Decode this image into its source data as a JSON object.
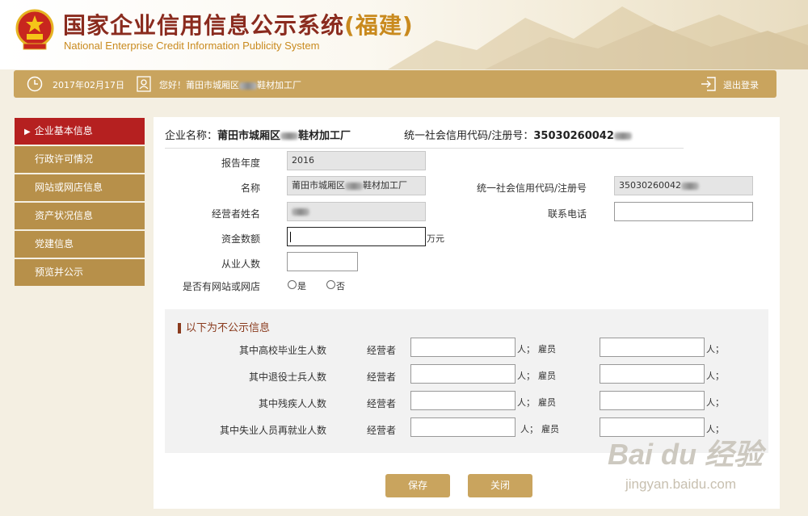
{
  "header": {
    "title_cn": "国家企业信用信息公示系统",
    "title_province": "(福建)",
    "title_en": "National Enterprise Credit Information Publicity System"
  },
  "topbar": {
    "date": "2017年02月17日",
    "greeting_prefix": "您好！莆田市城厢区",
    "greeting_suffix": "鞋材加工厂",
    "logout": "退出登录"
  },
  "sidebar": {
    "items": [
      {
        "label": "企业基本信息",
        "active": true
      },
      {
        "label": "行政许可情况"
      },
      {
        "label": "网站或网店信息"
      },
      {
        "label": "资产状况信息"
      },
      {
        "label": "党建信息"
      },
      {
        "label": "预览并公示"
      }
    ]
  },
  "summary": {
    "name_label": "企业名称：",
    "name_prefix": "莆田市城厢区",
    "name_suffix": "鞋材加工厂",
    "code_label": "统一社会信用代码/注册号：",
    "code_value": "35030260042"
  },
  "form": {
    "year_label": "报告年度",
    "year_value": "2016",
    "name_label": "名称",
    "name_prefix": "莆田市城厢区",
    "name_suffix": "鞋材加工厂",
    "code_label": "统一社会信用代码/注册号",
    "code_value": "35030260042",
    "operator_label": "经营者姓名",
    "phone_label": "联系电话",
    "capital_label": "资金数额",
    "capital_unit": "万元",
    "employees_label": "从业人数",
    "website_label": "是否有网站或网店",
    "yes": "是",
    "no": "否"
  },
  "nonpublic": {
    "title": "以下为不公示信息",
    "operator": "经营者",
    "unit_ren": "人；",
    "employee": "雇员",
    "rows": [
      "其中高校毕业生人数",
      "其中退役士兵人数",
      "其中残疾人人数",
      "其中失业人员再就业人数"
    ]
  },
  "buttons": {
    "save": "保存",
    "close": "关闭"
  },
  "watermark": {
    "big": "Bai du 经验",
    "small": "jingyan.baidu.com"
  },
  "colors": {
    "gold": "#c9a45e",
    "sidebar": "#b7904a",
    "active": "#b52020",
    "title": "#8a2b1e"
  }
}
